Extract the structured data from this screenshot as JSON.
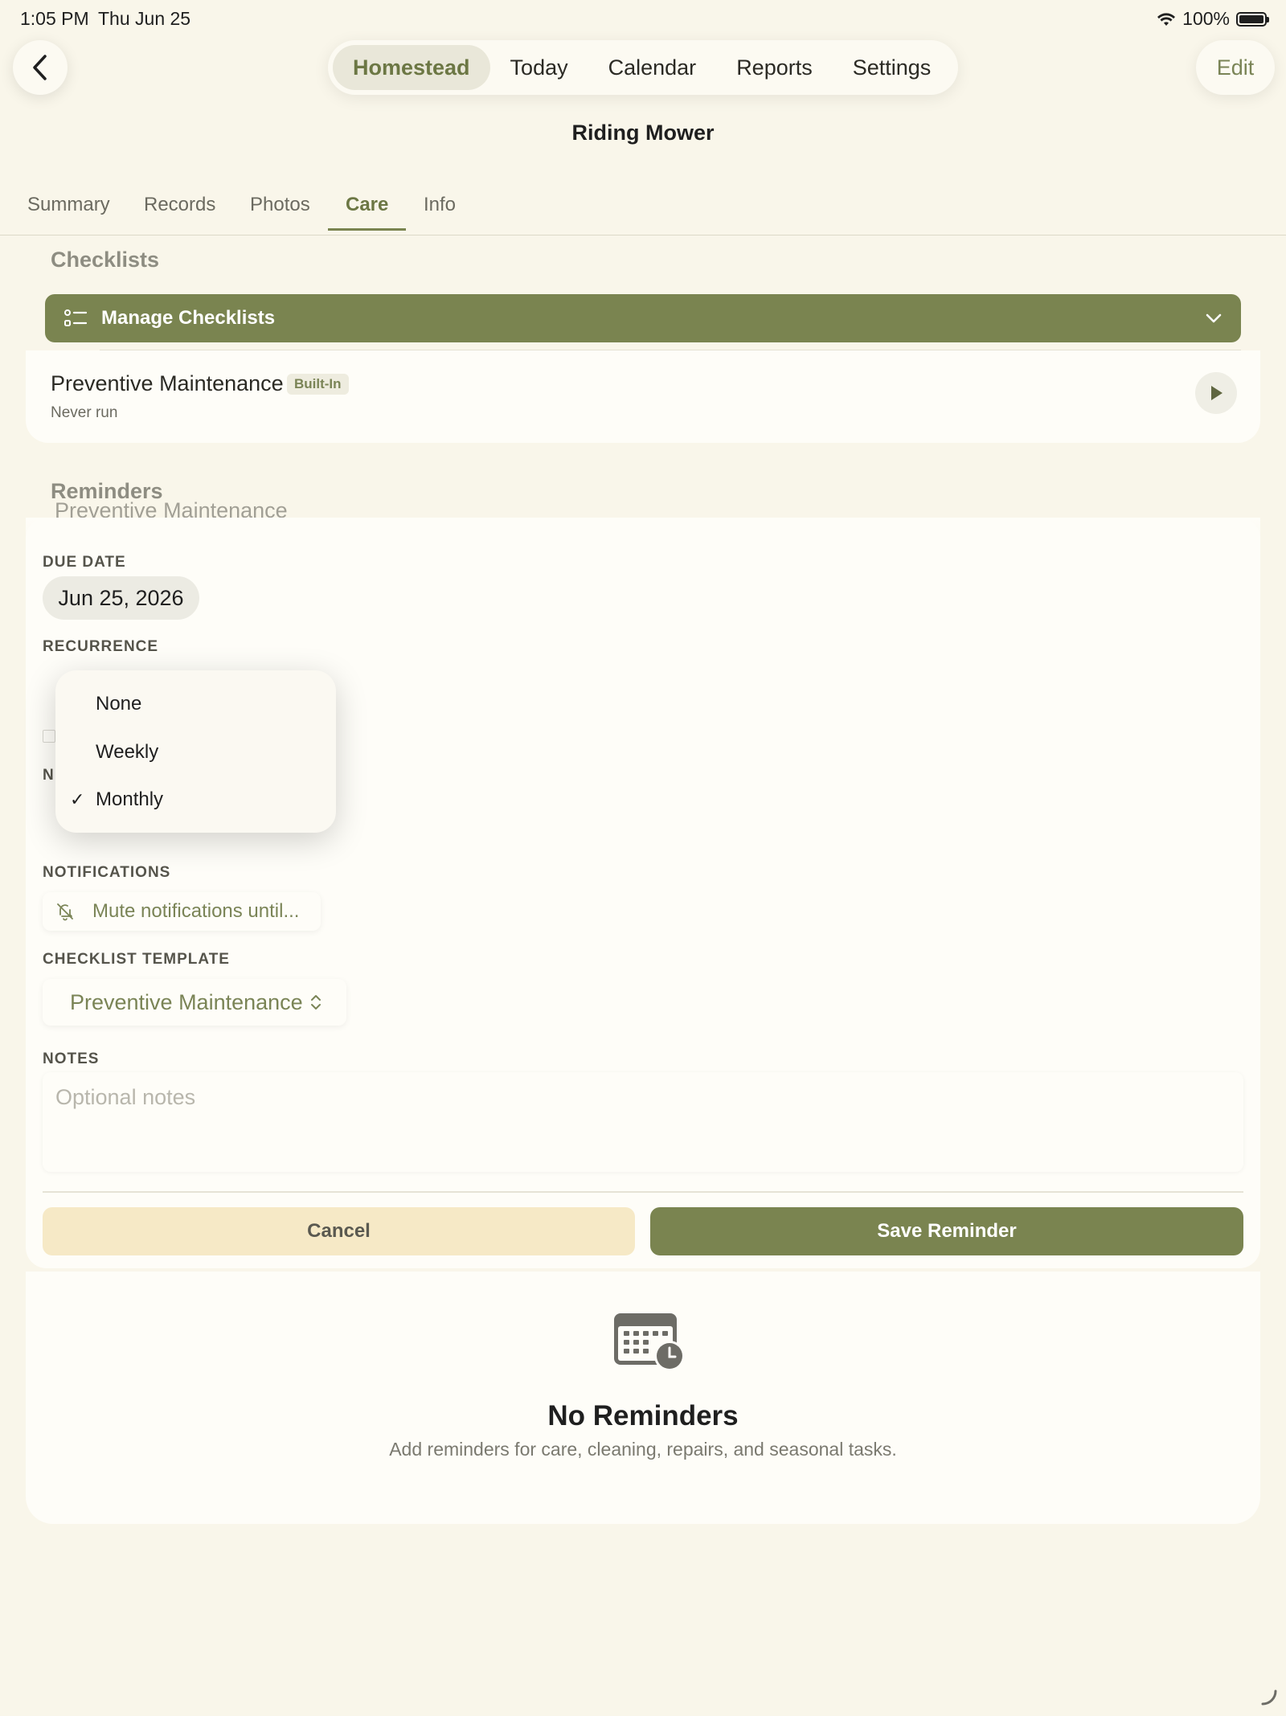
{
  "status_bar": {
    "time": "1:05 PM",
    "date": "Thu Jun 25",
    "battery": "100%"
  },
  "top_nav": {
    "items": [
      "Homestead",
      "Today",
      "Calendar",
      "Reports",
      "Settings"
    ],
    "active_index": 0
  },
  "header": {
    "edit_label": "Edit",
    "title": "Riding Mower"
  },
  "sub_tabs": {
    "items": [
      "Summary",
      "Records",
      "Photos",
      "Care",
      "Info"
    ],
    "active_index": 3
  },
  "checklists": {
    "section_title": "Checklists",
    "manage_label": "Manage Checklists",
    "items": [
      {
        "title": "Preventive Maintenance",
        "badge": "Built-In",
        "status": "Never run"
      }
    ]
  },
  "reminders": {
    "section_title": "Reminders",
    "form": {
      "title_value": "Preventive Maintenance",
      "due_date_label": "DUE DATE",
      "due_date_value": "Jun 25, 2026",
      "recurrence_label": "RECURRENCE",
      "recurrence_options": [
        "None",
        "Weekly",
        "Monthly"
      ],
      "recurrence_selected": "Monthly",
      "next_due_label": "N",
      "notifications_label": "NOTIFICATIONS",
      "mute_label": "Mute notifications until...",
      "checklist_template_label": "CHECKLIST TEMPLATE",
      "checklist_template_value": "Preventive Maintenance",
      "notes_label": "NOTES",
      "notes_placeholder": "Optional notes",
      "cancel_label": "Cancel",
      "save_label": "Save Reminder"
    },
    "empty_state": {
      "title": "No Reminders",
      "subtitle": "Add reminders for care, cleaning, repairs, and seasonal tasks."
    }
  },
  "colors": {
    "accent": "#7a8450",
    "background": "#f9f6ea",
    "card": "#fefdf8",
    "cancel_bg": "#f6e9c6"
  }
}
